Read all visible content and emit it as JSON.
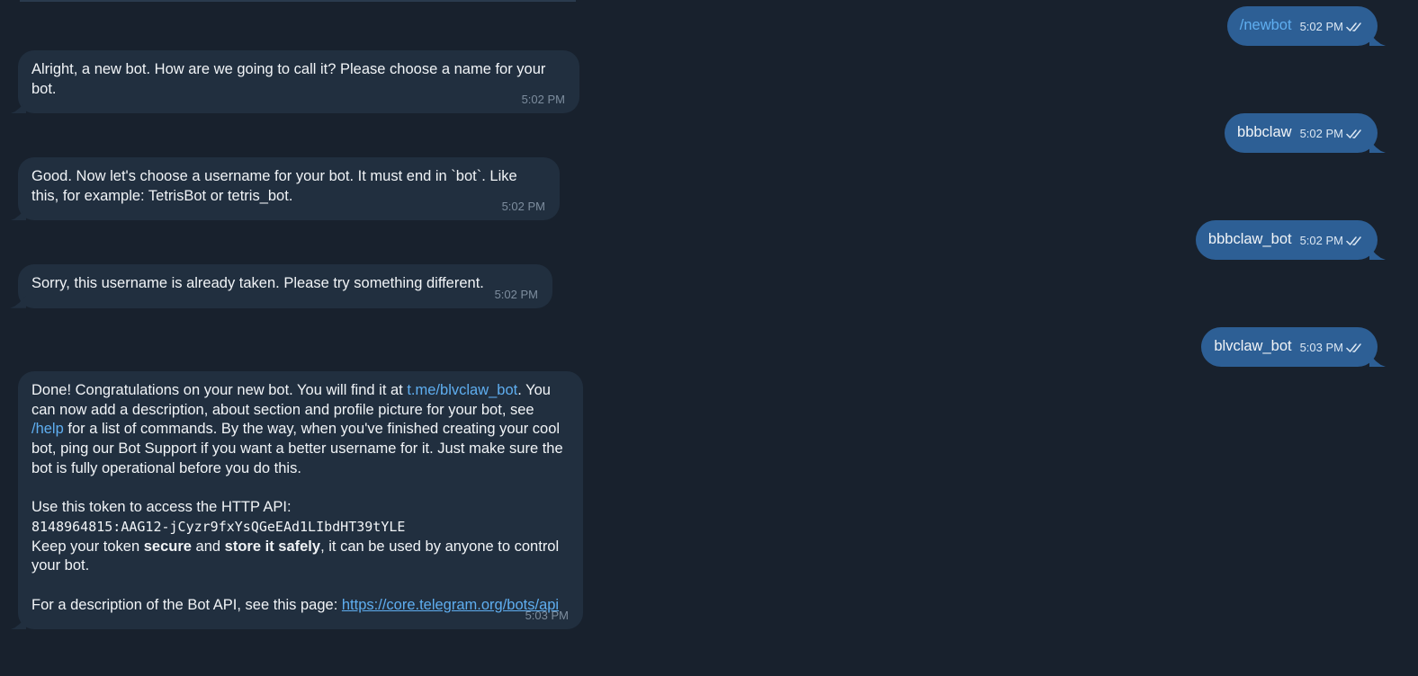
{
  "outgoing": [
    {
      "text": "/newbot",
      "time": "5:02 PM",
      "is_command": true
    },
    {
      "text": "bbbclaw",
      "time": "5:02 PM",
      "is_command": false
    },
    {
      "text": "bbbclaw_bot",
      "time": "5:02 PM",
      "is_command": false
    },
    {
      "text": "blvclaw_bot",
      "time": "5:03 PM",
      "is_command": false
    }
  ],
  "incoming": {
    "m1": {
      "text": "Alright, a new bot. How are we going to call it? Please choose a name for your bot.",
      "time": "5:02 PM"
    },
    "m2": {
      "text": "Good. Now let's choose a username for your bot. It must end in `bot`. Like this, for example: TetrisBot or tetris_bot.",
      "time": "5:02 PM"
    },
    "m3": {
      "text": "Sorry, this username is already taken. Please try something different.",
      "time": "5:02 PM"
    },
    "m4": {
      "p1_a": "Done! Congratulations on your new bot. You will find it at ",
      "p1_link": "t.me/blvclaw_bot",
      "p1_b": ". You can now add a description, about section and profile picture for your bot, see ",
      "p1_help": "/help",
      "p1_c": " for a list of commands. By the way, when you've finished creating your cool bot, ping our Bot Support if you want a better username for it. Just make sure the bot is fully operational before you do this.",
      "p2_label": "Use this token to access the HTTP API:",
      "token": "8148964815:AAG12-jCyzr9fxYsQGeEAd1LIbdHT39tYLE",
      "p3_a": "Keep your token ",
      "p3_secure": "secure",
      "p3_b": " and ",
      "p3_store": "store it safely",
      "p3_c": ", it can be used by anyone to control your bot.",
      "p4_a": "For a description of the Bot API, see this page: ",
      "p4_url": "https://core.telegram.org/bots/api",
      "time": "5:03 PM"
    }
  },
  "colors": {
    "background": "#18212d",
    "incoming_bubble": "#212f3f",
    "outgoing_bubble": "#2d5f95",
    "link": "#5faef0"
  }
}
